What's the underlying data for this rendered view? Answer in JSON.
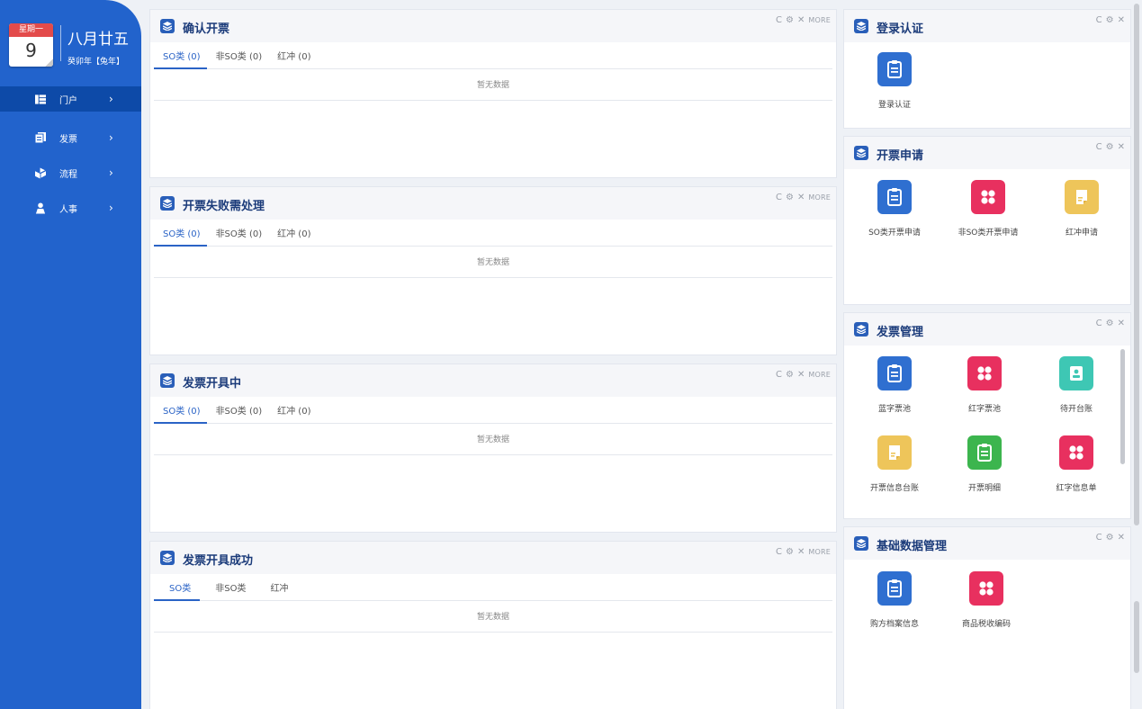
{
  "sidebar": {
    "calendar": {
      "weekday": "星期一",
      "day": "9"
    },
    "lunar_date": "八月廿五",
    "year_label": "癸卯年【兔年】",
    "nav": [
      {
        "label": "门户",
        "icon": "portal-icon"
      },
      {
        "label": "发票",
        "icon": "invoice-icon"
      },
      {
        "label": "流程",
        "icon": "flow-icon"
      },
      {
        "label": "人事",
        "icon": "person-icon"
      }
    ]
  },
  "panels": [
    {
      "title": "确认开票",
      "tabs": [
        "SO类 (0)",
        "非SO类 (0)",
        "红冲 (0)"
      ],
      "empty": "暂无数据"
    },
    {
      "title": "开票失败需处理",
      "tabs": [
        "SO类 (0)",
        "非SO类 (0)",
        "红冲 (0)"
      ],
      "empty": "暂无数据"
    },
    {
      "title": "发票开具中",
      "tabs": [
        "SO类 (0)",
        "非SO类 (0)",
        "红冲 (0)"
      ],
      "empty": "暂无数据"
    },
    {
      "title": "发票开具成功",
      "tabs": [
        "SO类",
        "非SO类",
        "红冲"
      ],
      "empty": "暂无数据"
    }
  ],
  "tools": {
    "refresh": "C",
    "settings": "⚙",
    "close": "✕",
    "more": "MORE"
  },
  "right_panels": [
    {
      "title": "登录认证",
      "tiles": [
        {
          "label": "登录认证",
          "color": "#2f6fd0",
          "icon": "doc-icon"
        }
      ]
    },
    {
      "title": "开票申请",
      "tiles": [
        {
          "label": "SO类开票申请",
          "color": "#2f6fd0",
          "icon": "doc-icon"
        },
        {
          "label": "非SO类开票申请",
          "color": "#e8305f",
          "icon": "grid-icon"
        },
        {
          "label": "红冲申请",
          "color": "#eec55a",
          "icon": "note-icon"
        }
      ]
    },
    {
      "title": "发票管理",
      "tiles": [
        {
          "label": "蓝字票池",
          "color": "#2f6fd0",
          "icon": "doc-icon"
        },
        {
          "label": "红字票池",
          "color": "#e8305f",
          "icon": "grid-icon"
        },
        {
          "label": "待开台账",
          "color": "#3ec7b4",
          "icon": "badge-icon"
        },
        {
          "label": "开票信息台账",
          "color": "#eec55a",
          "icon": "note-icon"
        },
        {
          "label": "开票明细",
          "color": "#3cb54e",
          "icon": "doc-icon"
        },
        {
          "label": "红字信息单",
          "color": "#e8305f",
          "icon": "grid-icon"
        }
      ]
    },
    {
      "title": "基础数据管理",
      "tiles": [
        {
          "label": "购方档案信息",
          "color": "#2f6fd0",
          "icon": "doc-icon"
        },
        {
          "label": "商品税收编码",
          "color": "#e8305f",
          "icon": "grid-icon"
        }
      ]
    }
  ]
}
